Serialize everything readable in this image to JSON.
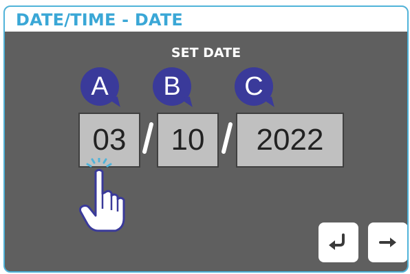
{
  "window": {
    "title": "DATE/TIME - DATE"
  },
  "header": {
    "label": "SET DATE"
  },
  "fields": [
    {
      "badge": "A",
      "value": "03"
    },
    {
      "badge": "B",
      "value": "10"
    },
    {
      "badge": "C",
      "value": "2022"
    }
  ],
  "separators": [
    "/",
    "/"
  ],
  "buttons": [
    {
      "icon": "return-arrow-icon"
    },
    {
      "icon": "right-arrow-icon"
    }
  ],
  "colors": {
    "title": "#3aa7d6",
    "panel": "#5f5f5f",
    "field": "#c0c0c0",
    "badge": "#3a3a9a",
    "border": "#4fb3d9"
  }
}
